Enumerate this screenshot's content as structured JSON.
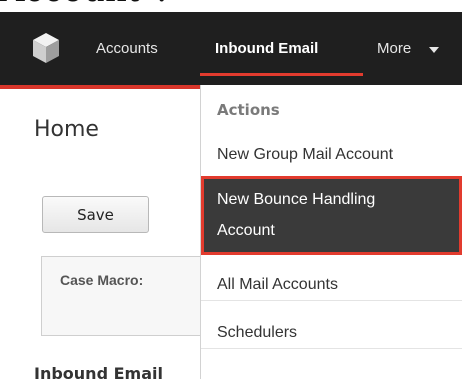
{
  "caption_fragment": "Account\".",
  "navbar": {
    "items": [
      {
        "label": "Accounts"
      },
      {
        "label": "Inbound Email"
      },
      {
        "label": "More"
      }
    ]
  },
  "page": {
    "title": "Home",
    "save_label": "Save",
    "case_macro_label": "Case Macro:",
    "section_heading": "Inbound Email"
  },
  "dropdown": {
    "header": "Actions",
    "items": [
      {
        "label": "New Group Mail Account"
      },
      {
        "line1": "New Bounce Handling",
        "line2": "Account"
      },
      {
        "label": "All Mail Accounts"
      },
      {
        "label": "Schedulers"
      }
    ]
  },
  "colors": {
    "navbar_bg": "#1f1f1f",
    "accent_red": "#e23b2e",
    "highlight_bg": "#3a3a3a"
  },
  "icons": {
    "logo": "cube-logo-icon",
    "more": "chevron-down-icon"
  }
}
